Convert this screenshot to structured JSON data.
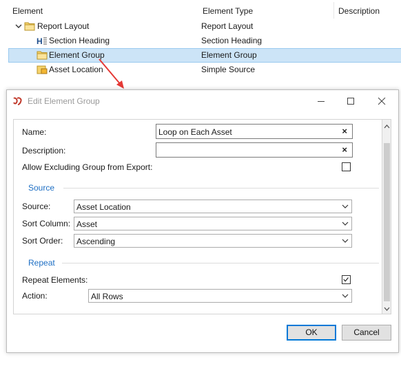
{
  "grid": {
    "columns": [
      "Element",
      "Element Type",
      "Description"
    ],
    "rows": [
      {
        "element": "Report Layout",
        "type": "Report Layout",
        "icon": "folder-open-icon",
        "expanded": true,
        "selected": false
      },
      {
        "element": "Section Heading",
        "type": "Section Heading",
        "icon": "heading-icon",
        "selected": false
      },
      {
        "element": "Element Group",
        "type": "Element Group",
        "icon": "folder-open-icon",
        "selected": true
      },
      {
        "element": "Asset Location",
        "type": "Simple Source",
        "icon": "source-icon",
        "selected": false
      }
    ]
  },
  "dialog": {
    "title": "Edit Element Group",
    "name_label": "Name:",
    "name_value": "Loop on Each Asset",
    "description_label": "Description:",
    "description_value": "",
    "allow_excluding_label": "Allow Excluding Group from Export:",
    "allow_excluding_checked": false,
    "source_section": "Source",
    "source_label": "Source:",
    "source_value": "Asset Location",
    "sort_column_label": "Sort Column:",
    "sort_column_value": "Asset",
    "sort_order_label": "Sort Order:",
    "sort_order_value": "Ascending",
    "repeat_section": "Repeat",
    "repeat_elements_label": "Repeat Elements:",
    "repeat_elements_checked": true,
    "action_label": "Action:",
    "action_value": "All Rows",
    "clear_glyph": "×",
    "ok_label": "OK",
    "cancel_label": "Cancel"
  },
  "colors": {
    "selection": "#cce4f7",
    "section_title": "#1e6fc4",
    "arrow": "#e53935",
    "default_button_border": "#0078d7"
  }
}
